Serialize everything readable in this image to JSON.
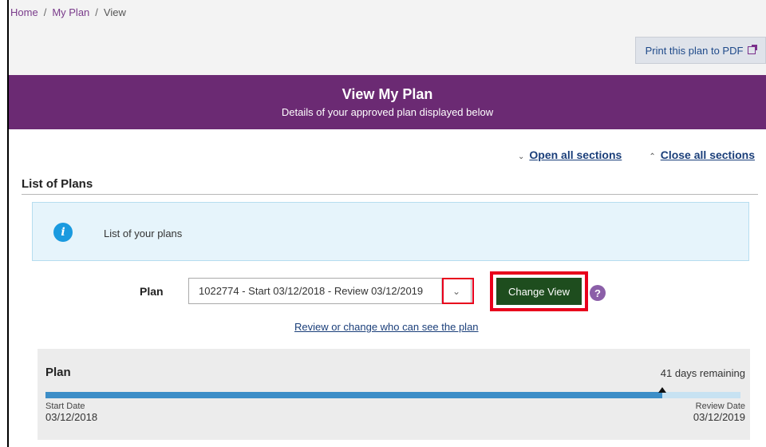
{
  "breadcrumb": {
    "items": [
      "Home",
      "My Plan",
      "View"
    ],
    "separator": "/"
  },
  "print_button": {
    "label": "Print this plan to PDF",
    "icon": "external-link-icon"
  },
  "banner": {
    "title": "View My Plan",
    "subtitle": "Details of your approved plan displayed below",
    "color": "#6b2a73"
  },
  "section_toggles": {
    "open_all": "Open all sections",
    "close_all": "Close all sections"
  },
  "list_of_plans": {
    "title": "List of Plans",
    "info_text": "List of your plans",
    "info_icon": "info-icon"
  },
  "plan_selector": {
    "label": "Plan",
    "selected_value": "1022774 - Start 03/12/2018 - Review 03/12/2019",
    "change_view_label": "Change View",
    "help_symbol": "?"
  },
  "review_link": "Review or change who can see the plan",
  "plan_card": {
    "title": "Plan",
    "remaining": "41 days remaining",
    "progress_fraction": 0.888,
    "start_label": "Start Date",
    "start_date": "03/12/2018",
    "review_label": "Review Date",
    "review_date": "03/12/2019"
  },
  "colors": {
    "accent_purple": "#6b2a73",
    "button_green": "#1e4d1e",
    "highlight_red": "#e8001c",
    "progress_blue": "#3d8ec7"
  }
}
